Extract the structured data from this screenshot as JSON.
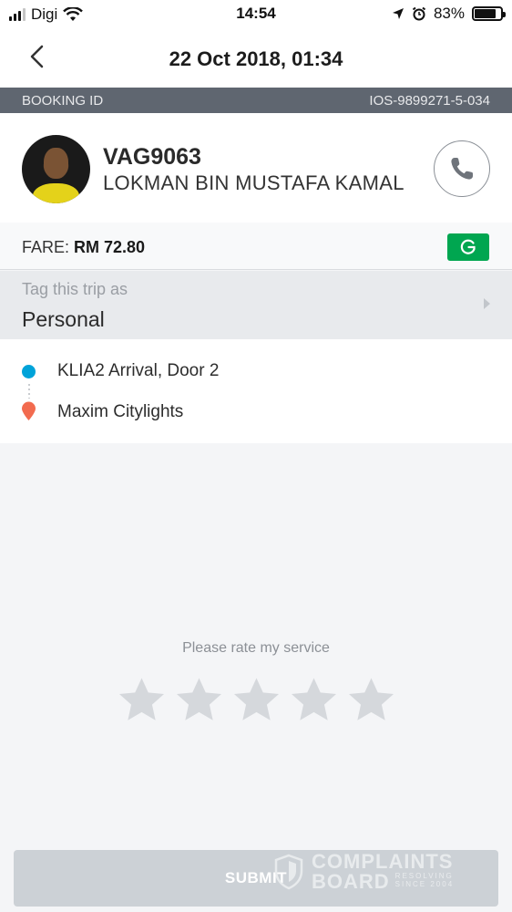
{
  "status_bar": {
    "carrier": "Digi",
    "time": "14:54",
    "battery": "83%",
    "battery_level": 0.83
  },
  "header": {
    "title": "22 Oct 2018, 01:34"
  },
  "booking": {
    "label": "BOOKING ID",
    "id": "IOS-9899271-5-034"
  },
  "driver": {
    "plate": "VAG9063",
    "name": "LOKMAN BIN MUSTAFA KAMAL"
  },
  "fare": {
    "label": "FARE:",
    "value": "RM 72.80",
    "badge": "G"
  },
  "tag": {
    "label": "Tag this trip as",
    "value": "Personal"
  },
  "route": {
    "pickup": "KLIA2 Arrival, Door 2",
    "dropoff": "Maxim Citylights"
  },
  "rating": {
    "prompt": "Please rate my service",
    "stars": 5,
    "selected": 0
  },
  "submit": {
    "label": "SUBMIT"
  },
  "watermark": {
    "line1": "COMPLAINTS",
    "line2": "BOARD",
    "tag1": "RESOLVING",
    "tag2": "SINCE 2004"
  },
  "colors": {
    "pickup": "#00a3d9",
    "dropoff": "#f26b4f",
    "grab_green": "#00a650",
    "booking_bar": "#5f6670"
  }
}
